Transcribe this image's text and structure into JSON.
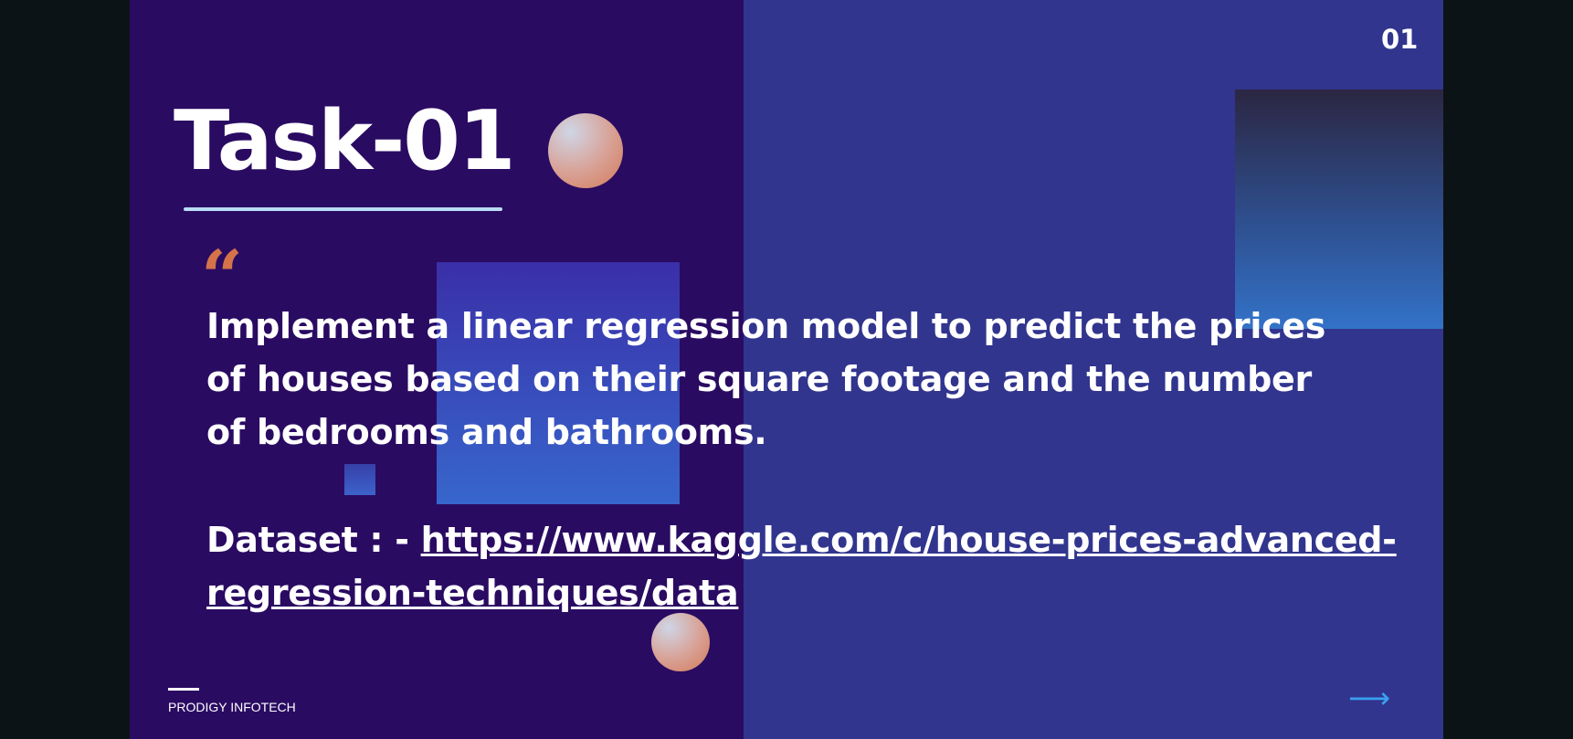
{
  "slide": {
    "page_number": "01",
    "title": "Task-01",
    "quote_mark": "“",
    "description": "Implement a linear regression model to predict the prices of houses based on their square footage and the number of bedrooms and bathrooms.",
    "dataset_label": "Dataset : - ",
    "dataset_link": "https://www.kaggle.com/c/house-prices-advanced-regression-techniques/data",
    "footer_brand": "PRODIGY INFOTECH",
    "next_arrow": "⟶"
  },
  "colors": {
    "left_bg": "#2a0b62",
    "right_bg": "#31358e",
    "accent_quote": "#d4734a",
    "arrow": "#3aa0f0",
    "underline": "#b9dcf5"
  },
  "icons": {
    "next": "arrow-right-icon",
    "quote": "quote-icon"
  }
}
